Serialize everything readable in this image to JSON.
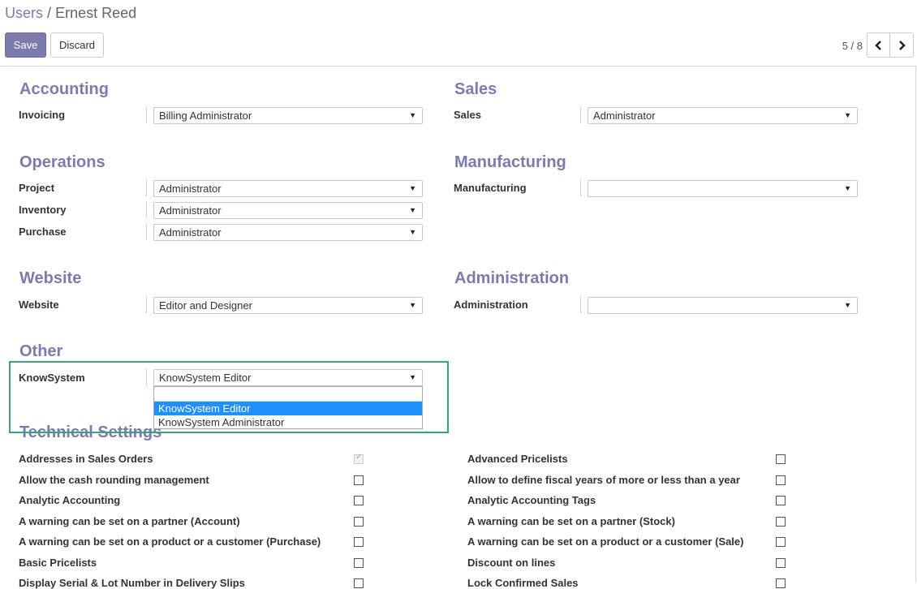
{
  "breadcrumb": {
    "parent": "Users",
    "separator": "/",
    "current": "Ernest Reed"
  },
  "toolbar": {
    "save_label": "Save",
    "discard_label": "Discard"
  },
  "pager": {
    "text": "5 / 8",
    "prev_icon": "chevron-left-icon",
    "next_icon": "chevron-right-icon"
  },
  "sections": {
    "accounting": {
      "title": "Accounting",
      "fields": [
        {
          "label": "Invoicing",
          "value": "Billing Administrator"
        }
      ]
    },
    "sales": {
      "title": "Sales",
      "fields": [
        {
          "label": "Sales",
          "value": "Administrator"
        }
      ]
    },
    "operations": {
      "title": "Operations",
      "fields": [
        {
          "label": "Project",
          "value": "Administrator"
        },
        {
          "label": "Inventory",
          "value": "Administrator"
        },
        {
          "label": "Purchase",
          "value": "Administrator"
        }
      ]
    },
    "manufacturing": {
      "title": "Manufacturing",
      "fields": [
        {
          "label": "Manufacturing",
          "value": ""
        }
      ]
    },
    "website": {
      "title": "Website",
      "fields": [
        {
          "label": "Website",
          "value": "Editor and Designer"
        }
      ]
    },
    "administration": {
      "title": "Administration",
      "fields": [
        {
          "label": "Administration",
          "value": ""
        }
      ]
    },
    "other": {
      "title": "Other",
      "fields": [
        {
          "label": "KnowSystem",
          "value": "KnowSystem Editor"
        }
      ]
    }
  },
  "knowsystem_dropdown": {
    "search_value": "",
    "options": [
      "KnowSystem Editor",
      "KnowSystem Administrator"
    ],
    "selected": "KnowSystem Editor"
  },
  "technical": {
    "title": "Technical Settings",
    "left": [
      {
        "label": "Addresses in Sales Orders",
        "checked": true
      },
      {
        "label": "Allow the cash rounding management",
        "checked": false
      },
      {
        "label": "Analytic Accounting",
        "checked": false
      },
      {
        "label": "A warning can be set on a partner (Account)",
        "checked": false
      },
      {
        "label": "A warning can be set on a product or a customer (Purchase)",
        "checked": false
      },
      {
        "label": "Basic Pricelists",
        "checked": false
      },
      {
        "label": "Display Serial & Lot Number in Delivery Slips",
        "checked": false
      }
    ],
    "right": [
      {
        "label": "Advanced Pricelists",
        "checked": false
      },
      {
        "label": "Allow to define fiscal years of more or less than a year",
        "checked": false
      },
      {
        "label": "Analytic Accounting Tags",
        "checked": false
      },
      {
        "label": "A warning can be set on a partner (Stock)",
        "checked": false
      },
      {
        "label": "A warning can be set on a product or a customer (Sale)",
        "checked": false
      },
      {
        "label": "Discount on lines",
        "checked": false
      },
      {
        "label": "Lock Confirmed Sales",
        "checked": false
      }
    ]
  },
  "colors": {
    "accent": "#7c7bad",
    "highlight": "#3aa184",
    "selected_option": "#1e90ff"
  }
}
